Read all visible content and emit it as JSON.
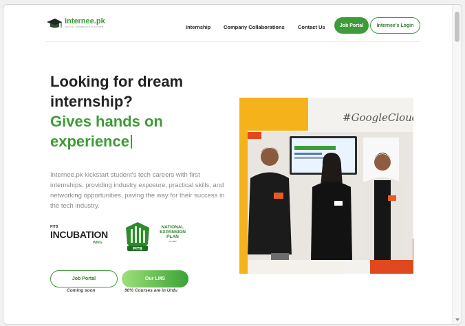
{
  "brand": {
    "name": "Internee.pk",
    "tagline": "VIRTUAL INTERNSHIP PLATFORM"
  },
  "nav": {
    "items": [
      "Internship",
      "Company Collaborations",
      "Contact Us"
    ],
    "job_portal": "Job Portal",
    "login": "Internee's Login"
  },
  "hero": {
    "title_line1": "Looking for dream",
    "title_line2": "internship?",
    "subtitle_line1": "Gives hands on",
    "subtitle_line2": "experience",
    "description": "Internee.pk kickstart student's tech careers with first internships, providing industry exposure, practical skills, and networking opportunities, paving the way for their success in the tech industry."
  },
  "partners": {
    "pitb": "PITB",
    "incubation": "INCUBATION",
    "wing": "WING",
    "pitb_emblem": "PITB",
    "nep_line1": "NATIONAL",
    "nep_line2": "EXPANSION",
    "nep_line3": "PLAN",
    "nep_small": "OF NEP"
  },
  "cta": {
    "job_portal": "Job Portal",
    "job_portal_note": "Coming soon",
    "lms": "Our LMS",
    "lms_note": "90% Courses are in Urdu"
  },
  "photo": {
    "hashtag": "#GoogleCloud"
  },
  "colors": {
    "brand_green": "#3e9b39",
    "accent_yellow": "#f6b21b",
    "accent_red": "#e0491f"
  }
}
